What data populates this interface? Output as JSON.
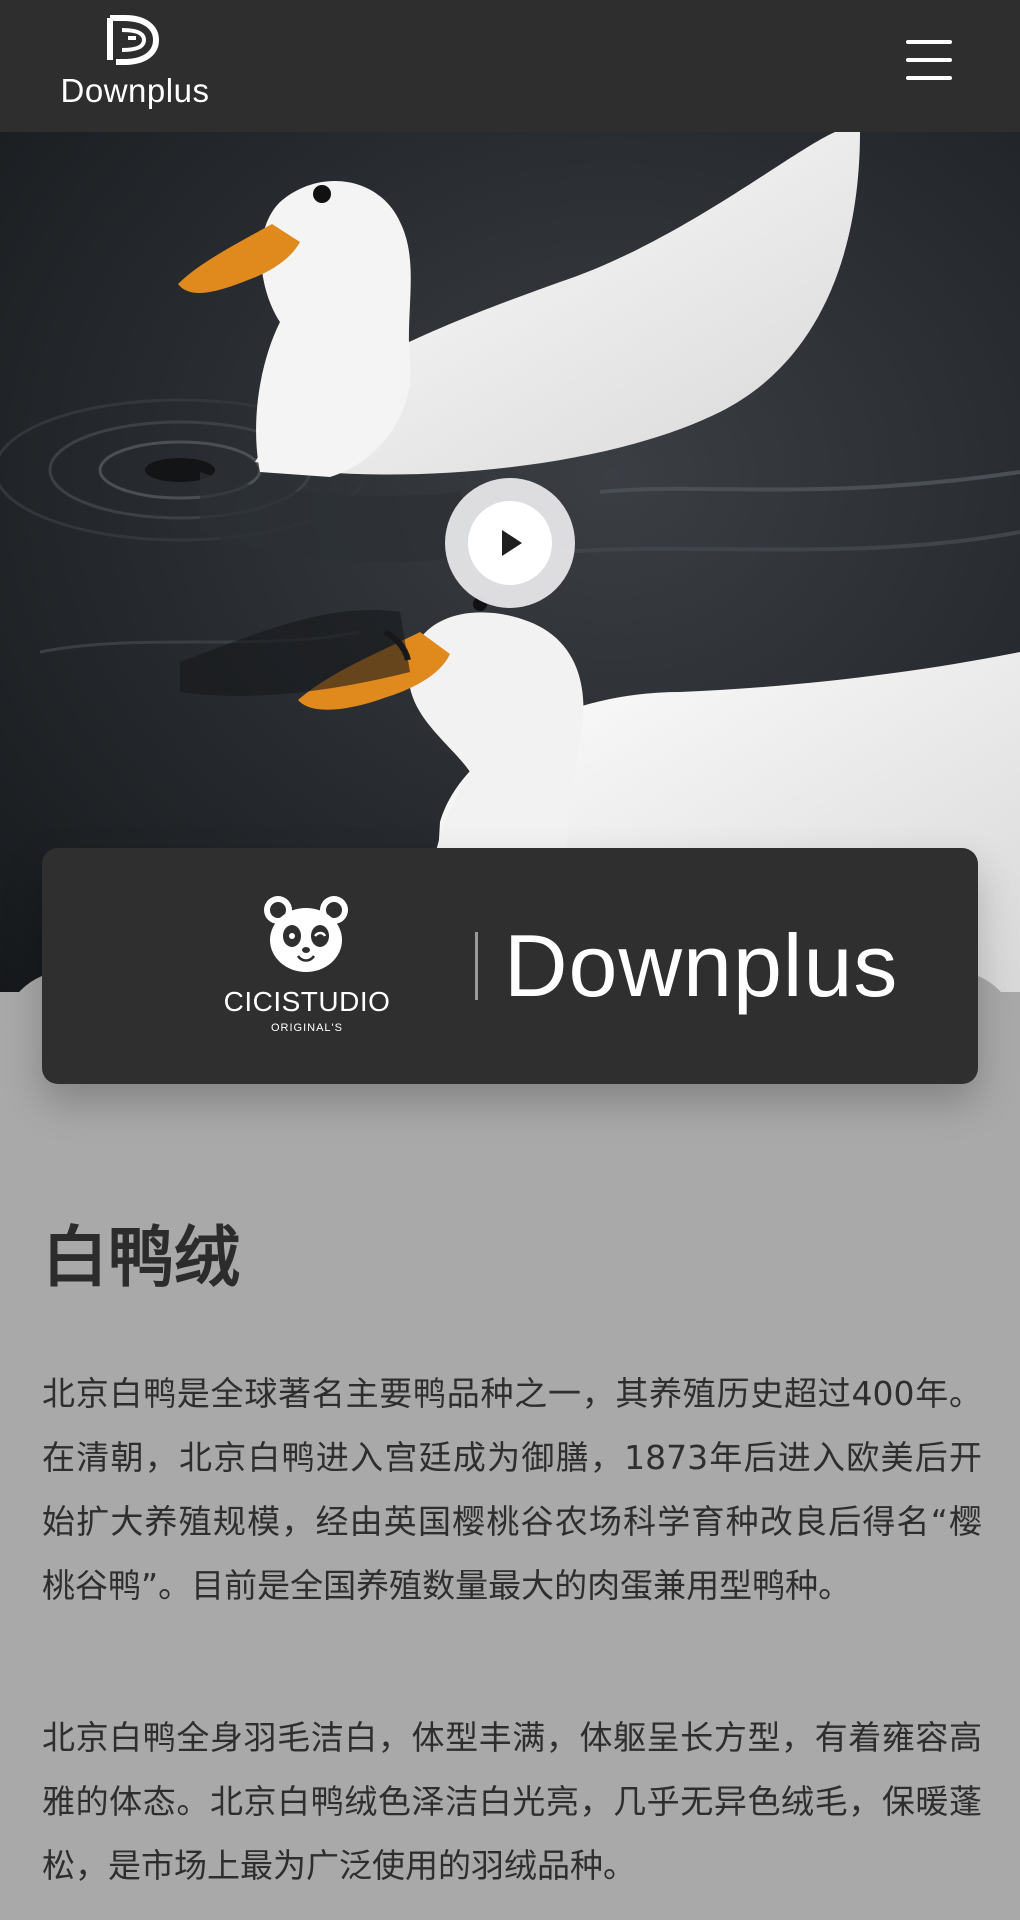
{
  "header": {
    "logo_text": "Downplus",
    "menu_icon": "hamburger-menu-icon"
  },
  "hero": {
    "media": "two white ducks swimming on dark water",
    "play_icon": "play-icon"
  },
  "brand_card": {
    "partner_name": "CICISTUDIO",
    "partner_sub": "ORIGINAL'S",
    "brand_name": "Downplus"
  },
  "article": {
    "title": "白鸭绒",
    "paragraphs": [
      "北京白鸭是全球著名主要鸭品种之一，其养殖历史超过400年。在清朝，北京白鸭进入宫廷成为御膳，1873年后进入欧美后开始扩大养殖规模，经由英国樱桃谷农场科学育种改良后得名“樱桃谷鸭”。目前是全国养殖数量最大的肉蛋兼用型鸭种。",
      "北京白鸭全身羽毛洁白，体型丰满，体躯呈长方型，有着雍容高雅的体态。北京白鸭绒色泽洁白光亮，几乎无异色绒毛，保暖蓬松，是市场上最为广泛使用的羽绒品种。"
    ]
  },
  "colors": {
    "header_bg": "#2e2e2e",
    "card_bg": "#2f2f30",
    "page_bg": "#a9a9a9",
    "text": "#2e2e2e",
    "beak": "#e08a1e"
  }
}
